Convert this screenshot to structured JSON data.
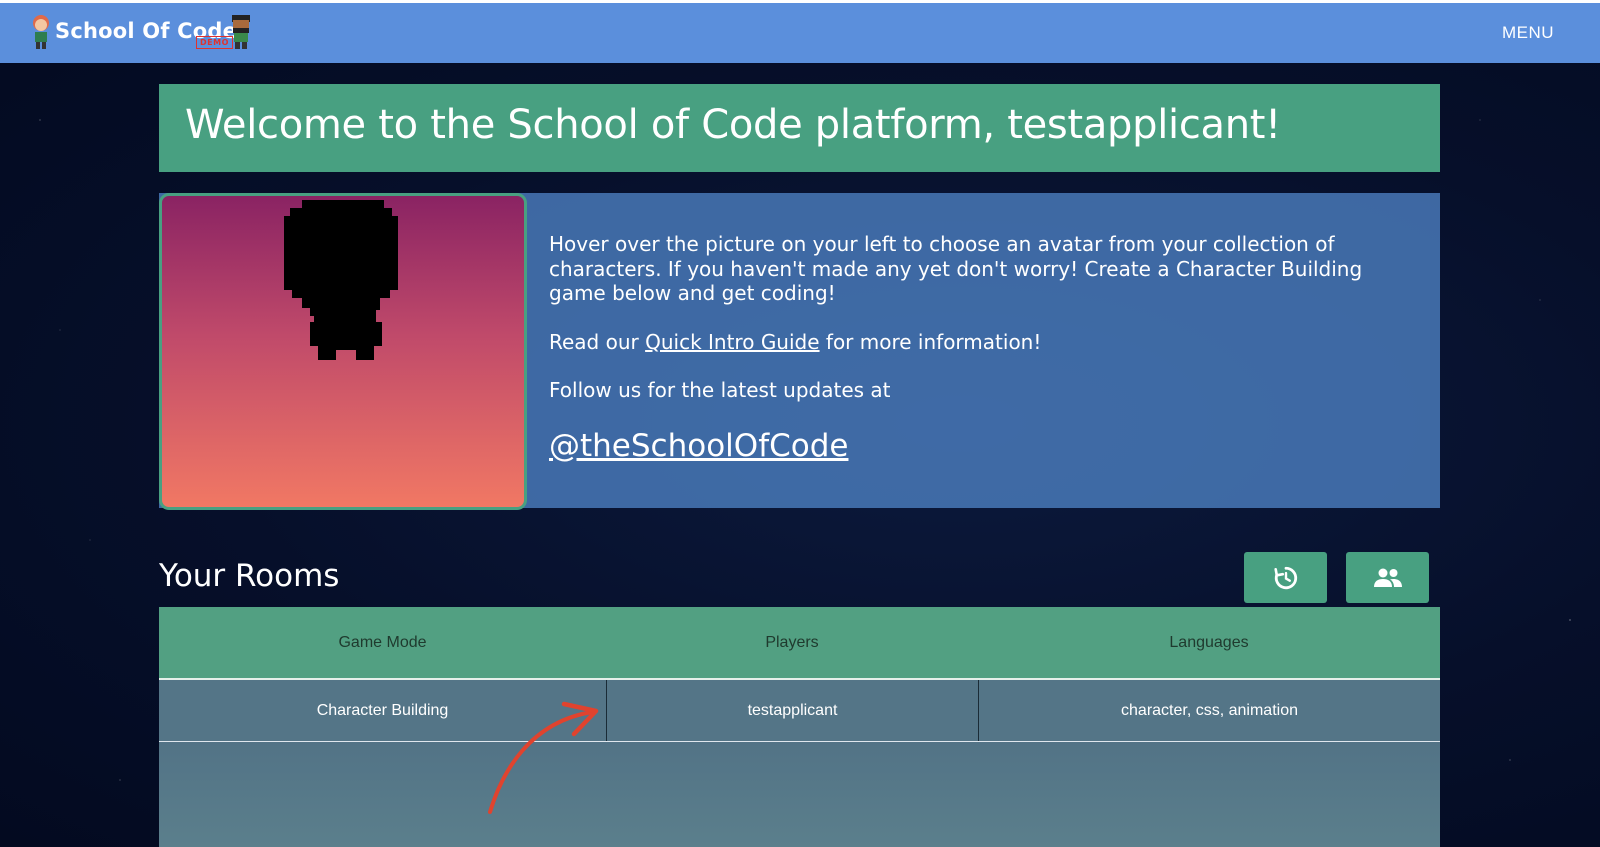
{
  "header": {
    "logo_text": "School Of Code",
    "logo_badge": "DEMO",
    "menu_label": "MENU"
  },
  "welcome": {
    "title": "Welcome to the School of Code platform, testapplicant!"
  },
  "intro": {
    "paragraph1": "Hover over the picture on your left to choose an avatar from your collection of characters. If you haven't made any yet don't worry! Create a Character Building game below and get coding!",
    "read_prefix": "Read our ",
    "guide_link": "Quick Intro Guide",
    "read_suffix": " for more information!",
    "follow_text": "Follow us for the latest updates at",
    "twitter_handle": "@theSchoolOfCode"
  },
  "rooms": {
    "title": "Your Rooms",
    "columns": [
      "Game Mode",
      "Players",
      "Languages"
    ],
    "rows": [
      {
        "game_mode": "Character Building",
        "players": "testapplicant",
        "languages": "character, css, animation"
      }
    ]
  },
  "icons": {
    "refresh": "history-refresh-icon",
    "people": "people-group-icon",
    "menu": "menu"
  },
  "colors": {
    "navbar": "#5b8fdc",
    "accent_green": "#48a081",
    "info_panel": "#4a7dbd",
    "table_row": "#547587",
    "annotation_arrow": "#e0432e"
  }
}
